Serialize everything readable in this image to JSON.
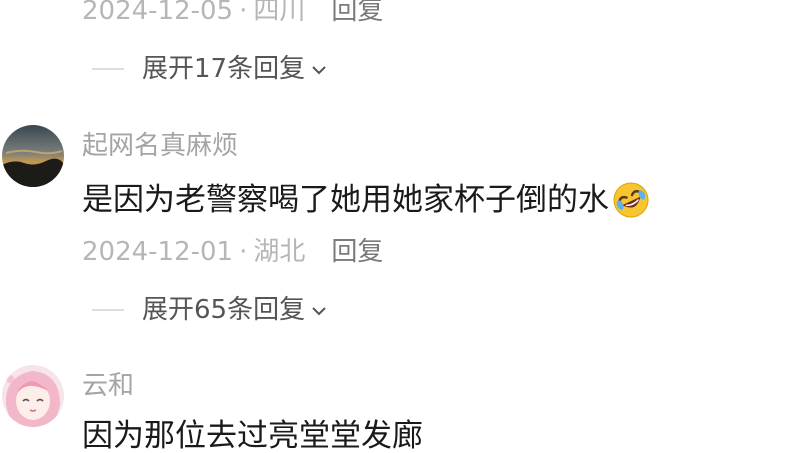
{
  "comments": [
    {
      "date": "2024-12-05",
      "location": "四川",
      "reply_label": "回复",
      "expand_label": "展开17条回复"
    },
    {
      "username": "起网名真麻烦",
      "text": "是因为老警察喝了她用她家杯子倒的水",
      "emoji": "rolling-on-floor-laughing-emoji",
      "date": "2024-12-01",
      "location": "湖北",
      "reply_label": "回复",
      "expand_label": "展开65条回复"
    },
    {
      "username": "云和",
      "text": "因为那位去过亮堂堂发廊"
    }
  ],
  "separator": "·",
  "colors": {
    "meta_text": "#b6b6b6",
    "reply_text": "#7a7a7a",
    "username": "#a4a4a4",
    "content": "#1a1a1a",
    "expand_text": "#555555"
  }
}
